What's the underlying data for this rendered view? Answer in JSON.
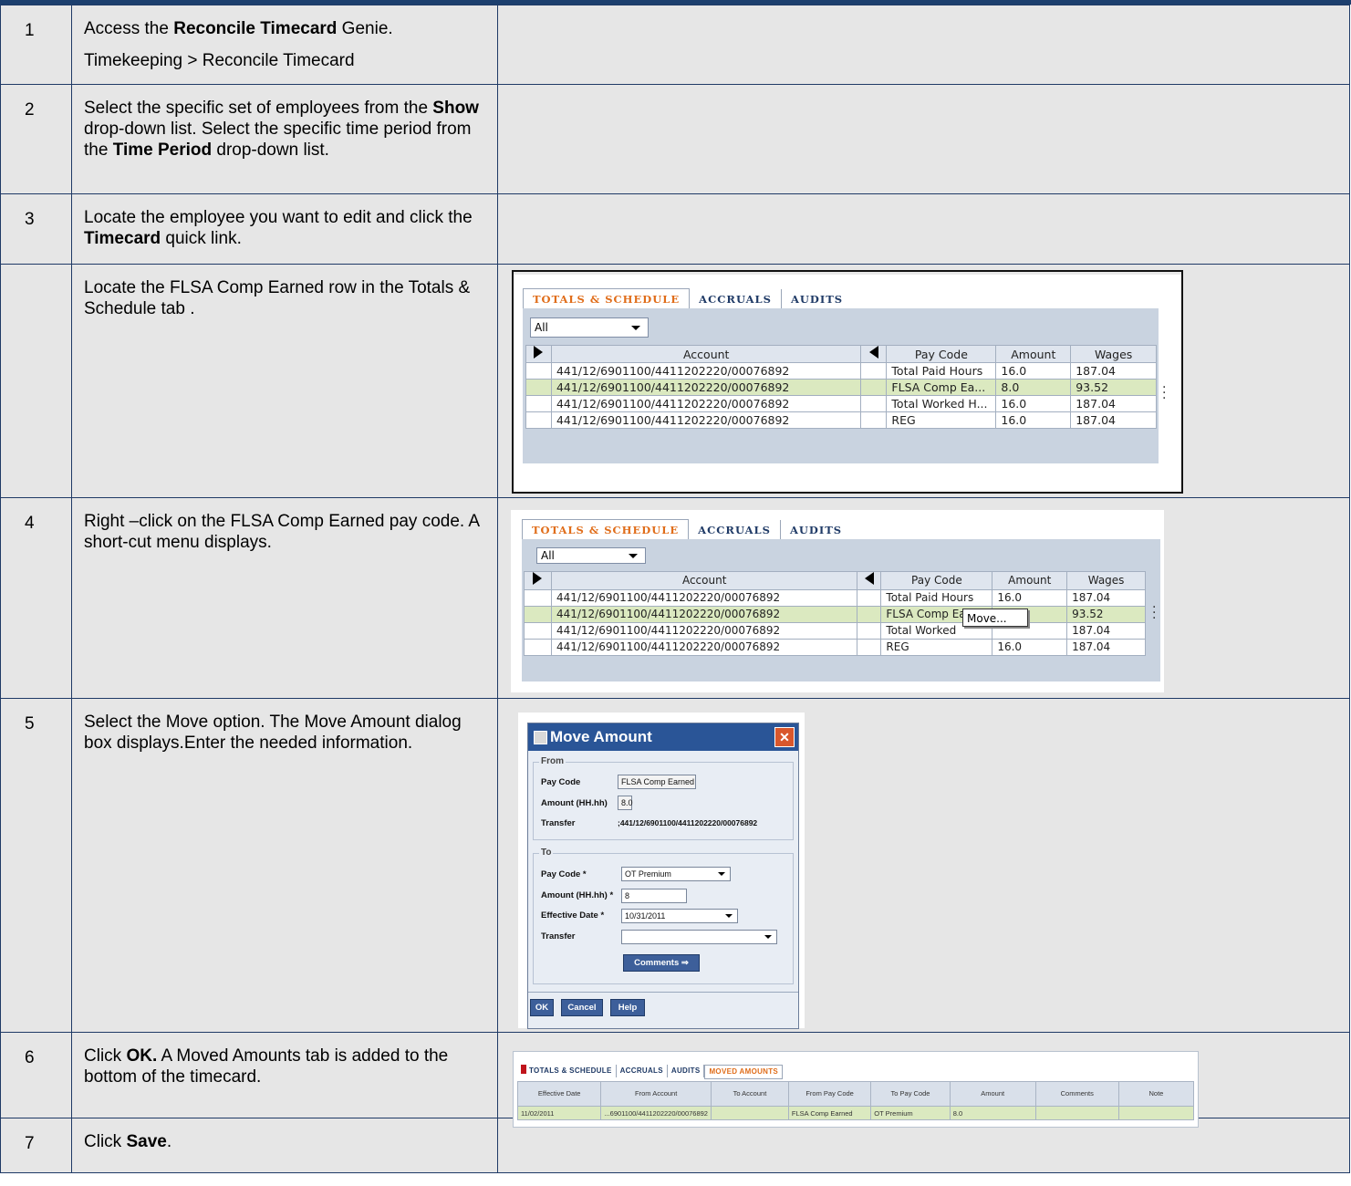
{
  "steps": [
    {
      "num": "1",
      "line1_pre": "Access the ",
      "line1_bold": "Reconcile Timecard",
      "line1_post": " Genie.",
      "line2": "Timekeeping > Reconcile Timecard"
    },
    {
      "num": "2",
      "t1": "Select the specific set of employees from the ",
      "b1": "Show",
      "t2": " drop-down list. Select the specific time period from the ",
      "b2": "Time Period",
      "t3": " drop-down list."
    },
    {
      "num": "3",
      "t1": "Locate the employee you want to edit and click the ",
      "b1": "Timecard",
      "t2": " quick link."
    },
    {
      "num": "",
      "text": "Locate the FLSA Comp Earned row in the Totals & Schedule tab ."
    },
    {
      "num": "4",
      "text": "Right –click on the FLSA Comp Earned pay code. A short-cut menu displays."
    },
    {
      "num": "5",
      "text": "Select the Move option. The Move Amount dialog box displays.Enter the needed information."
    },
    {
      "num": "6",
      "t1": "Click ",
      "b1": "OK.",
      "t2": " A Moved Amounts tab is added to the bottom of the timecard."
    },
    {
      "num": "7",
      "t1": "Click ",
      "b1": "Save",
      "t2": "."
    }
  ],
  "totals_ui": {
    "tabs": [
      "TOTALS & SCHEDULE",
      "ACCRUALS",
      "AUDITS"
    ],
    "filter": "All",
    "columns": [
      "Account",
      "Pay Code",
      "Amount",
      "Wages"
    ],
    "rows_shot1": [
      [
        "441/12/6901100/4411202220/00076892",
        "Total Paid Hours",
        "16.0",
        "187.04"
      ],
      [
        "441/12/6901100/4411202220/00076892",
        "FLSA Comp Ea...",
        "8.0",
        "93.52"
      ],
      [
        "441/12/6901100/4411202220/00076892",
        "Total Worked H...",
        "16.0",
        "187.04"
      ],
      [
        "441/12/6901100/4411202220/00076892",
        "REG",
        "16.0",
        "187.04"
      ]
    ],
    "rows_shot2": [
      [
        "441/12/6901100/4411202220/00076892",
        "Total Paid Hours",
        "16.0",
        "187.04"
      ],
      [
        "441/12/6901100/4411202220/00076892",
        "FLSA Comp Ea...",
        "8.0",
        "93.52"
      ],
      [
        "441/12/6901100/4411202220/00076892",
        "Total Worked",
        "",
        "187.04"
      ],
      [
        "441/12/6901100/4411202220/00076892",
        "REG",
        "16.0",
        "187.04"
      ]
    ],
    "context_menu_item": "Move..."
  },
  "dialog": {
    "title": "Move Amount",
    "from_legend": "From",
    "from_paycode_label": "Pay Code",
    "from_paycode_value": "FLSA Comp Earned",
    "from_amount_label": "Amount (HH.hh)",
    "from_amount_value": "8.0",
    "from_transfer_label": "Transfer",
    "from_transfer_value": ";441/12/6901100/4411202220/00076892",
    "to_legend": "To",
    "to_paycode_label": "Pay Code *",
    "to_paycode_value": "OT Premium",
    "to_amount_label": "Amount (HH.hh) *",
    "to_amount_value": "8",
    "to_date_label": "Effective Date *",
    "to_date_value": "10/31/2011",
    "to_transfer_label": "Transfer",
    "to_transfer_value": "",
    "comments_btn": "Comments ⇒",
    "ok": "OK",
    "cancel": "Cancel",
    "help": "Help"
  },
  "moved": {
    "tabs": [
      "TOTALS & SCHEDULE",
      "ACCRUALS",
      "AUDITS",
      "MOVED AMOUNTS"
    ],
    "headers": [
      "Effective Date",
      "From Account",
      "To Account",
      "From Pay Code",
      "To Pay Code",
      "Amount",
      "Comments",
      "Note"
    ],
    "row": [
      "11/02/2011",
      "...6901100/4411202220/00076892",
      "",
      "FLSA Comp Earned",
      "OT Premium",
      "8.0",
      "",
      ""
    ]
  }
}
